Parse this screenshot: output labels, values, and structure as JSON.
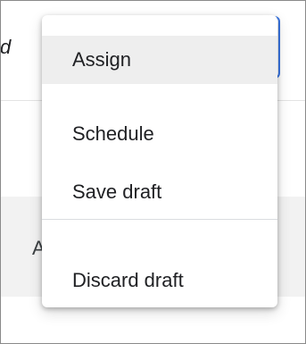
{
  "background": {
    "header_text_fragment": "d",
    "row_letter_fragment": "A"
  },
  "menu": {
    "items": [
      {
        "label": "Assign",
        "highlighted": true
      },
      {
        "label": "Schedule",
        "highlighted": false
      },
      {
        "label": "Save draft",
        "highlighted": false
      },
      {
        "label": "Discard draft",
        "highlighted": false
      }
    ]
  },
  "colors": {
    "focus_border": "#3b78e7",
    "highlight_background": "#eeeeee",
    "text": "#202124"
  }
}
